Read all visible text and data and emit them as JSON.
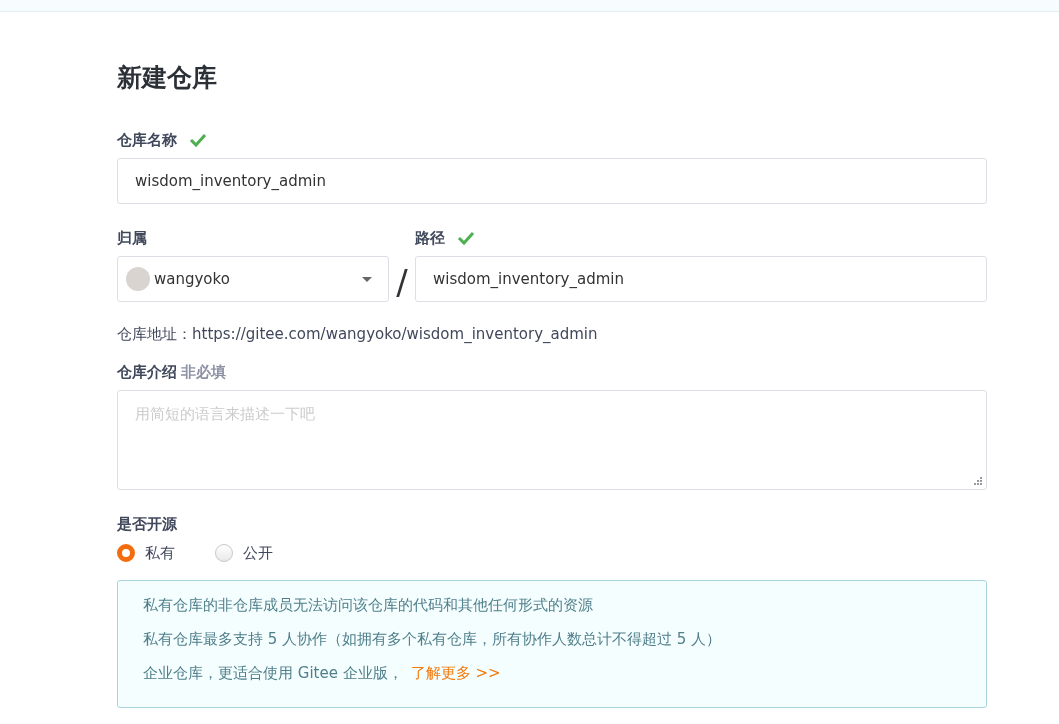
{
  "page_title": "新建仓库",
  "name_field": {
    "label": "仓库名称",
    "valid": true,
    "value": "wisdom_inventory_admin"
  },
  "owner": {
    "label": "归属",
    "value": "wangyoko"
  },
  "separator": "/",
  "path_field": {
    "label": "路径",
    "valid": true,
    "value": "wisdom_inventory_admin"
  },
  "address": "仓库地址：https://gitee.com/wangyoko/wisdom_inventory_admin",
  "description": {
    "label": "仓库介绍",
    "hint": "非必填",
    "placeholder": "用简短的语言来描述一下吧"
  },
  "visibility": {
    "label": "是否开源",
    "options": [
      {
        "label": "私有",
        "selected": true
      },
      {
        "label": "公开",
        "selected": false
      }
    ]
  },
  "notice": {
    "lines": [
      "私有仓库的非仓库成员无法访问该仓库的代码和其他任何形式的资源",
      "私有仓库最多支持 5 人协作（如拥有多个私有仓库，所有协作人数总计不得超过 5 人）",
      "企业仓库，更适合使用 Gitee 企业版，"
    ],
    "link": "了解更多 >>"
  }
}
